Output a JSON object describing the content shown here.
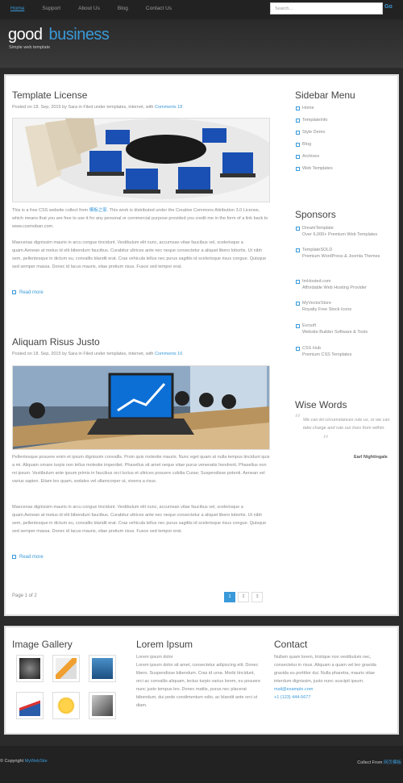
{
  "nav": [
    "Home",
    "Support",
    "About Us",
    "Blog",
    "Contact Us"
  ],
  "search": {
    "placeholder": "Search...",
    "go": "Go"
  },
  "brand": {
    "logo_a": "good",
    "logo_b": "business",
    "slogan": "Simple web template"
  },
  "posts": [
    {
      "title": "Template License",
      "meta": "Posted on 18. Sep, 2015 by Sara in Filed under templates, internet, with",
      "comments": "Comments 18",
      "p1_pre": "This is a free CSS website collect from",
      "p1_link": "模板之家",
      "p1_post": ". This work is distributed under the Creative Commons Attribution 3.0 License, which means that you are free to use it for any personal or commercial purpose provided you credit me in the form of a link back to www.cssmoban.com.",
      "p2": "Maecenas dignissim mauris in arcu congue tincidunt. Vestibulum elit nunc, accumsan vitae faucibus vel, scelerisque a quam.Aenean at metus id elit bibendum faucibus. Curabitur ultrices ante nec neque consectetur a aliquet libero lobortis. Ut nibh sem, pellentesque in dictum eu, convallis blandit erat. Cras vehicula tellus nec purus sagittis id scelerisque risus congue. Quisque sed semper massa. Donec id lacus mauris, vitae pretium risus. Fusce sed tempor erat.",
      "more": "Read more"
    },
    {
      "title": "Aliquam Risus Justo",
      "meta": "Posted on 18. Sep, 2015 by Sara in Filed under templates, internet, with",
      "comments": "Comments 16",
      "p1": "Pellentesque posuere enim et ipsum dignissim convallis. Proin quis molestie mauris. Nunc eget quam at nulla tempus tincidunt quis a mi. Aliquam ornare turpis non tellus molestie imperdiet. Phasellus sit amet neque vitae purus venenatis hendrerit. Phasellus non mi ipsum. Vestibulum ante ipsum primis in faucibus orci luctus et ultrices posuere cubilia Curae; Suspendisse potenti. Aenean vel varius sapien. Etiam leo quam, sodales vel ullamcorper ut, viverra a risus.",
      "p2": "Maecenas dignissim mauris in arcu congue tincidunt. Vestibulum elit nunc, accumsan vitae faucibus vel, scelerisque a quam.Aenean at metus id elit bibendum faucibus. Curabitur ultrices ante nec neque consectetur a aliquet libero lobortis. Ut nibh sem, pellentesque in dictum eu, convallis blandit erat. Cras vehicula tellus nec purus sagittis id scelerisque risus congue. Quisque sed semper massa. Donec id lacus mauris, vitae pretium risus. Fusce sed tempor erat.",
      "more": "Read more"
    }
  ],
  "pagination": {
    "label": "Page 1 of 2",
    "pages": [
      "1",
      "2",
      "3"
    ]
  },
  "sidebar": {
    "menu_title": "Sidebar Menu",
    "menu": [
      "Home",
      "TemplateInfo",
      "Style Demo",
      "Blog",
      "Archives",
      "Web Templates"
    ],
    "sponsors_title": "Sponsors",
    "sponsors": [
      {
        "name": "DreamTemplate",
        "desc": "Over 6,000+ Premium Web Templates"
      },
      {
        "name": "TemplateSOLD",
        "desc": "Premium WordPress & Joomla Themes"
      },
      {
        "name": "ImHosted.com",
        "desc": "Affordable Web Hosting Provider"
      },
      {
        "name": "MyVectorStore",
        "desc": "Royalty Free Stock Icons"
      },
      {
        "name": "Evrsoft",
        "desc": "Website Builder Software & Tools"
      },
      {
        "name": "CSS Hub",
        "desc": "Premium CSS Templates"
      }
    ],
    "wise_title": "Wise Words",
    "quote": "We can let circumstances rule us, or we can take charge and rule our lives from within.",
    "author": "Earl Nightingale"
  },
  "gallery": {
    "title": "Image Gallery"
  },
  "lorem": {
    "title": "Lorem Ipsum",
    "text": "Lorem ipsum dolor\nLorem ipsum dolor sit amet, consectetur adipiscing elit. Donec libero. Suspendisse bibendum. Cras id urna. Morbi tincidunt, orci ac convallis aliquam, lectus turpis varius lorem, eu posuere nunc justo tempus leo. Donec mattis, purus nec placerat bibendum, dui pede condimentum odio, ac blandit ante orci ut diam."
  },
  "contact": {
    "title": "Contact",
    "text": "Nullam quam lorem, tristique non vestibulum nec, consectetur in risus. Aliquam a quam vel leo gravida gravida eu porttitor dui. Nulla pharetra, mauris vitae interdum dignissim, justo nunc suscipit ipsum.",
    "email": "mail@example.com",
    "phone": "+1 (123) 444-5677"
  },
  "footer": {
    "left_pre": "© Copyright",
    "left_link": "MyWebSite",
    "right_pre": "Collect From",
    "right_link": "网页模板"
  }
}
